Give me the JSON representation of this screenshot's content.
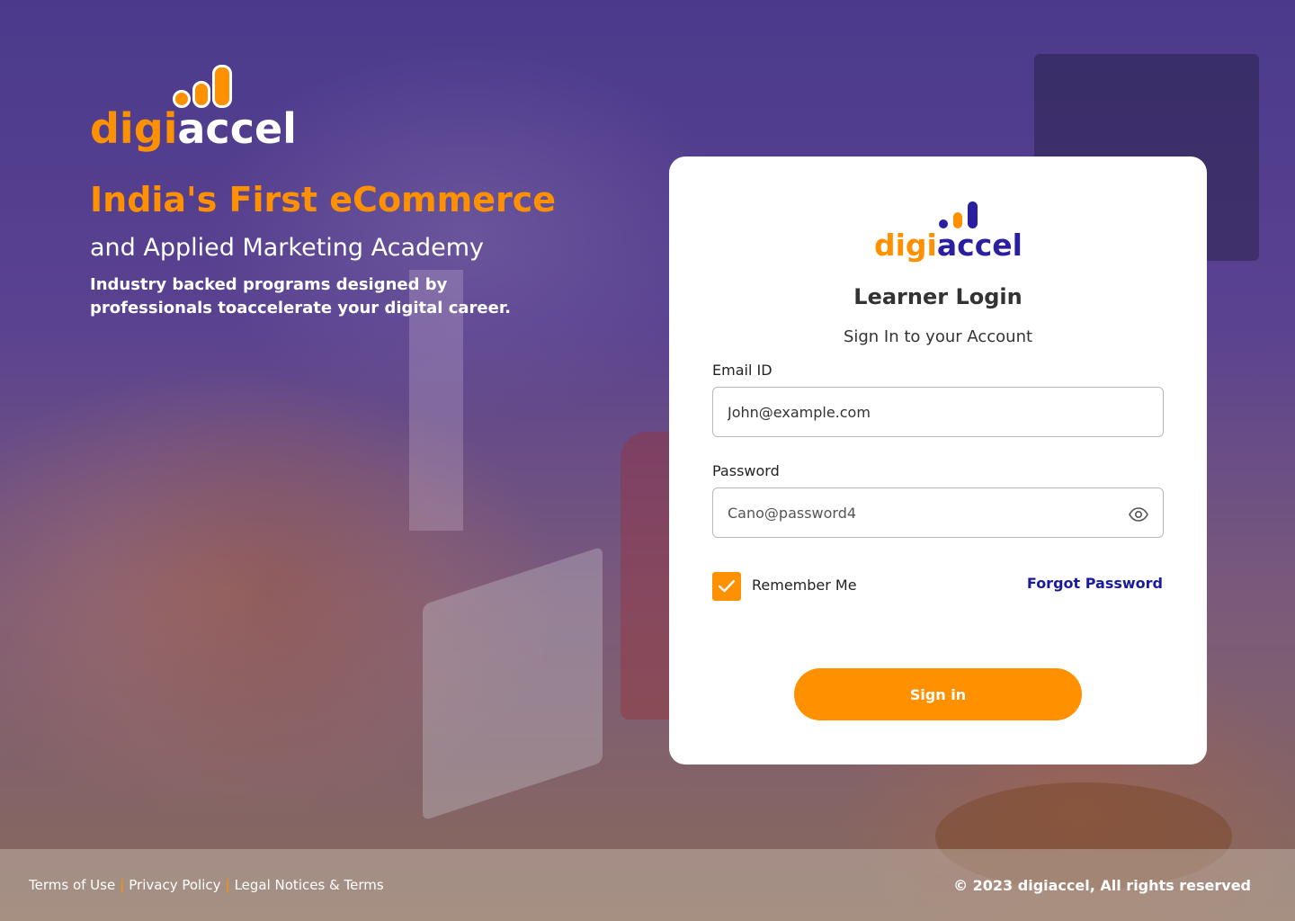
{
  "brand": {
    "logo_part1": "digi",
    "logo_part2": "accel",
    "orange": "#ff9100",
    "navy": "#2a1f9e"
  },
  "hero": {
    "title": "India's First eCommerce",
    "subtitle": "and Applied Marketing Academy",
    "description": "Industry backed programs designed by professionals toaccelerate your digital career."
  },
  "login": {
    "title": "Learner Login",
    "subtitle": "Sign In to your Account",
    "email_label": "Email ID",
    "email_value": "John@example.com",
    "password_label": "Password",
    "password_value": "Cano@password4",
    "password_toggle_icon": "eye-icon",
    "remember_label": "Remember Me",
    "remember_checked": true,
    "forgot_label": "Forgot Password",
    "signin_label": "Sign in"
  },
  "footer": {
    "links": [
      "Terms of Use",
      "Privacy Policy",
      "Legal Notices & Terms"
    ],
    "separator": "|",
    "copyright": "© 2023 digiaccel, All rights reserved"
  }
}
